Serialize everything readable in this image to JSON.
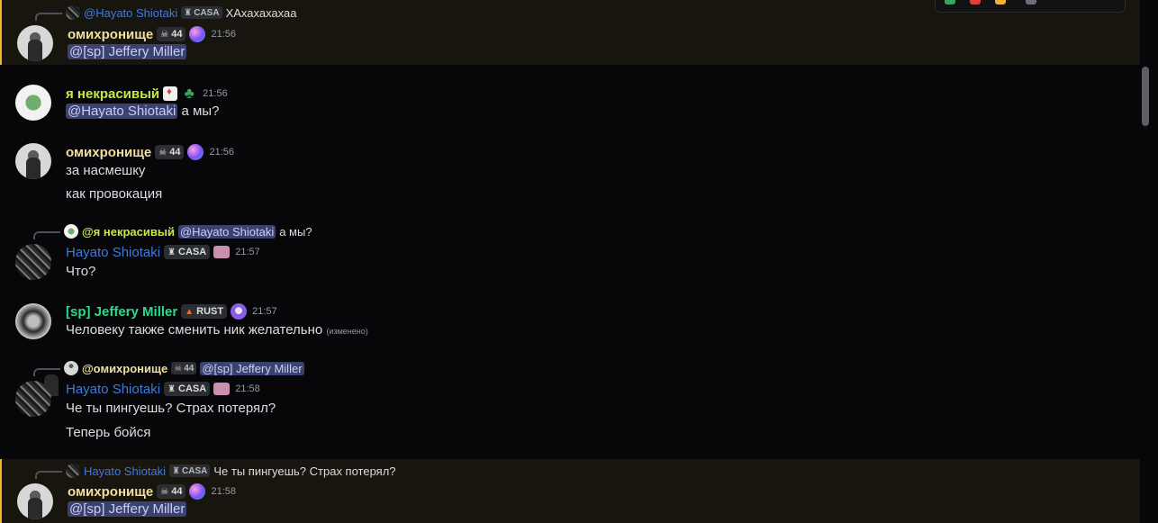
{
  "messages": [
    {
      "id": "m1",
      "reply": {
        "author": "@Hayato Shiotaki",
        "tag": "CASA",
        "text": "ХАхахахахаа"
      },
      "author": "омихронище",
      "tag": "44",
      "time": "21:56",
      "mention": "@[sp] Jeffery Miller"
    },
    {
      "id": "m2",
      "author": "я некрасивый",
      "time": "21:56",
      "mention": "@Hayato Shiotaki",
      "text": "а мы?"
    },
    {
      "id": "m3",
      "author": "омихронище",
      "tag": "44",
      "time": "21:56",
      "lines": [
        "за насмешку",
        "как провокация"
      ]
    },
    {
      "id": "m4",
      "reply": {
        "author": "@я некрасивый",
        "mention": "@Hayato Shiotaki",
        "text": "а мы?"
      },
      "author": "Hayato Shiotaki",
      "tag": "CASA",
      "time": "21:57",
      "text": "Что?"
    },
    {
      "id": "m5",
      "author": "[sp] Jeffery Miller",
      "tag": "RUST",
      "time": "21:57",
      "text": "Человеку также сменить ник желательно",
      "edited": "(изменено)"
    },
    {
      "id": "m6",
      "reply": {
        "author": "@омихронище",
        "tag": "44",
        "mention": "@[sp] Jeffery Miller"
      },
      "author": "Hayato Shiotaki",
      "tag": "CASA",
      "time": "21:58",
      "lines": [
        "Че ты пингуешь? Страх потерял?",
        "Теперь бойся"
      ]
    },
    {
      "id": "m7",
      "reply": {
        "author": "Hayato Shiotaki",
        "tag": "CASA",
        "text": "Че ты пингуешь? Страх потерял?"
      },
      "author": "омихронище",
      "tag": "44",
      "time": "21:58",
      "mention": "@[sp] Jeffery Miller"
    }
  ],
  "colors": {
    "mention_highlight": "#f0b232",
    "omi": "#f1dfa1",
    "ya": "#c5e84a",
    "hayato": "#3f7ae0",
    "jeffery": "#2fd98a"
  }
}
